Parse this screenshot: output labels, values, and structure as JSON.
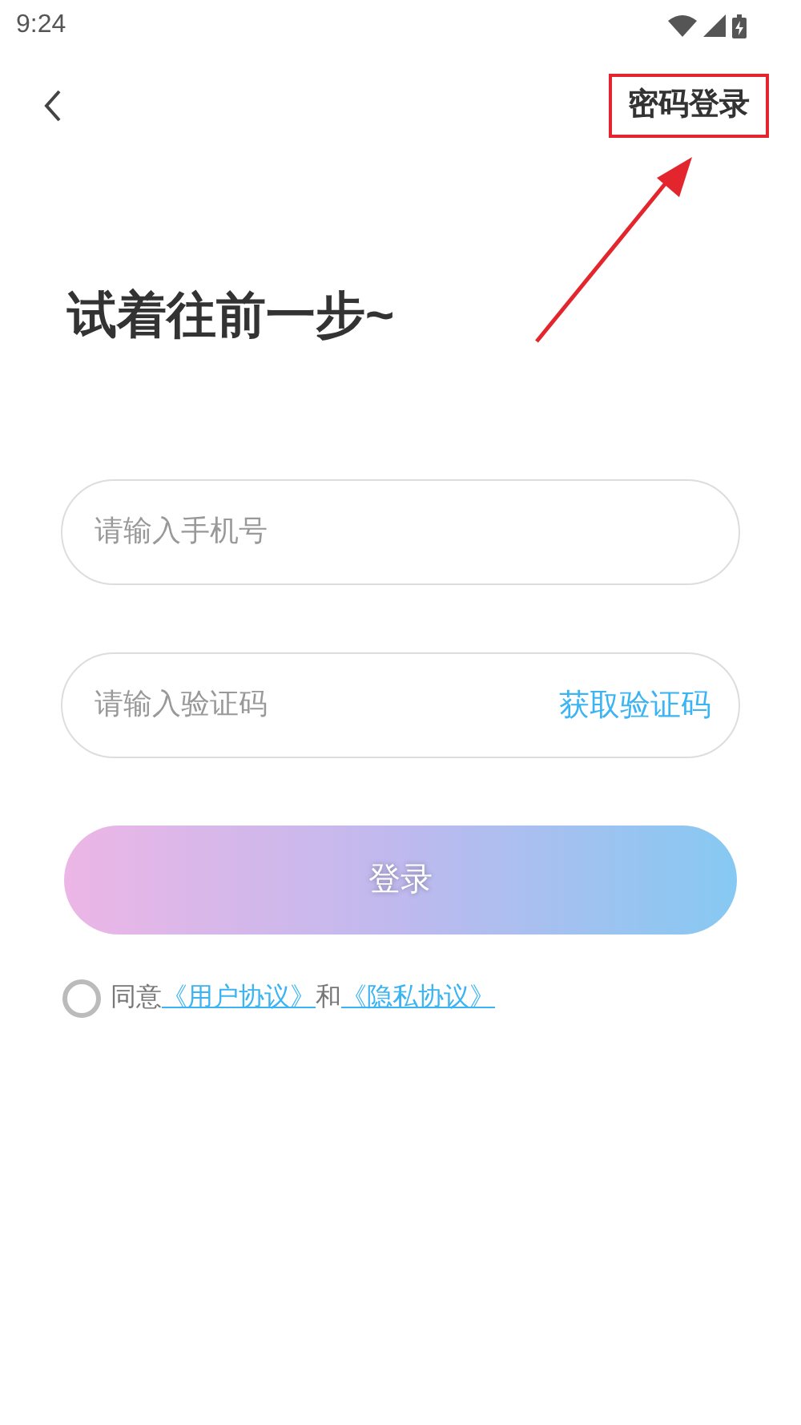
{
  "status_bar": {
    "time": "9:24"
  },
  "header": {
    "password_login": {
      "label": "密码登录",
      "highlighted": true
    }
  },
  "title": "试着往前一步~",
  "phone_field": {
    "placeholder": "请输入手机号"
  },
  "code_field": {
    "placeholder": "请输入验证码",
    "action": "获取验证码"
  },
  "login_button": {
    "label": "登录",
    "disabled": true
  },
  "agreement": {
    "checked": false,
    "prefix": "同意",
    "link_1": "《用户协议》",
    "conjunction": "和",
    "link_2": "《隐私协议》"
  }
}
